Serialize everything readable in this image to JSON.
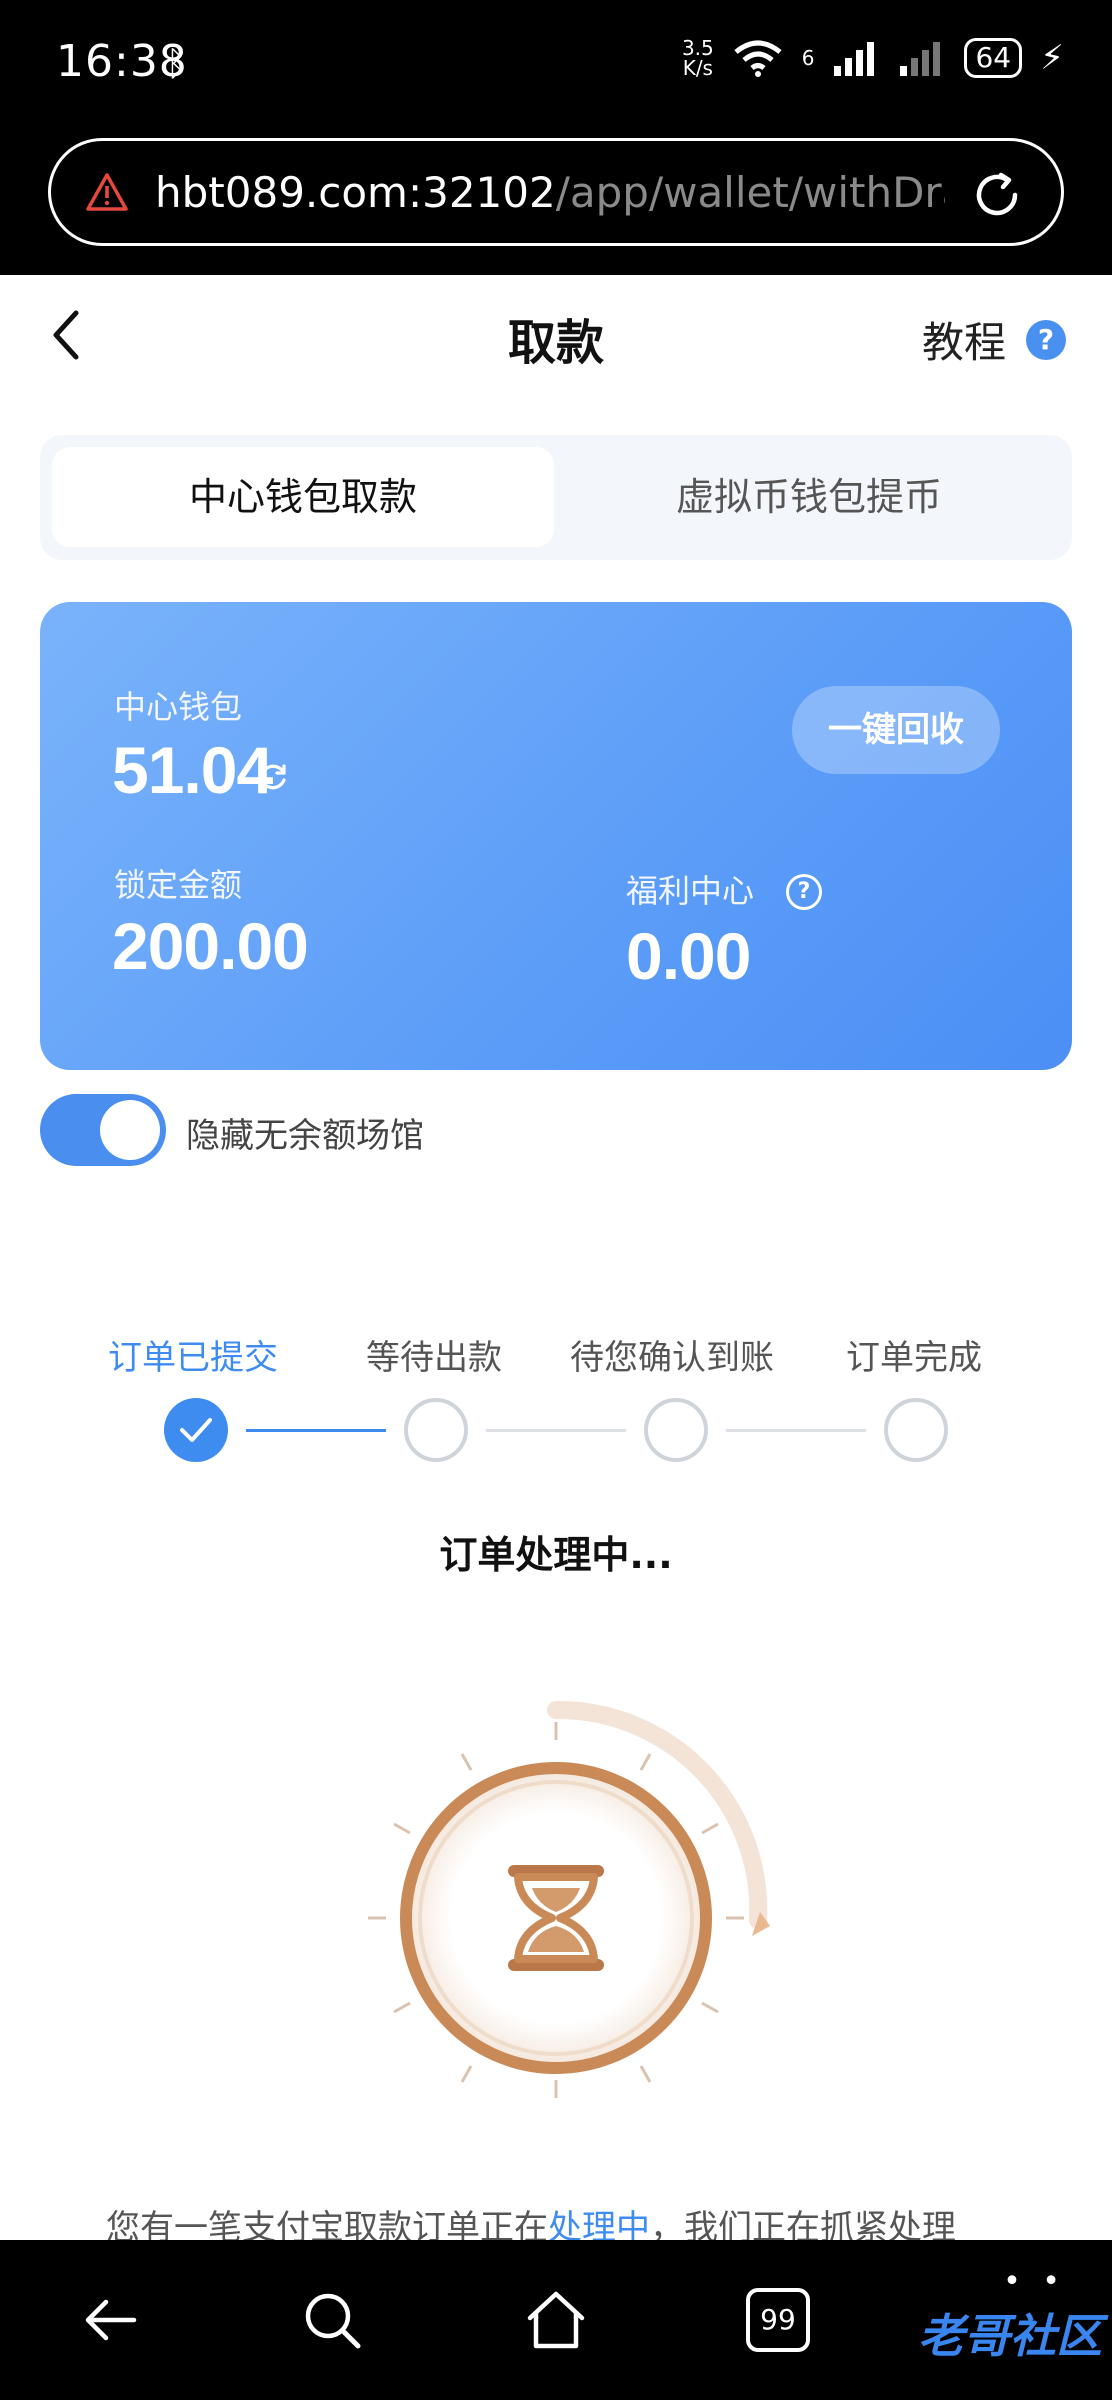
{
  "status_bar": {
    "time": "16:38",
    "net_speed_value": "3.5",
    "net_speed_unit": "K/s",
    "net_type": "6",
    "battery": "64"
  },
  "browser": {
    "url_host": "hbt089.com:32102",
    "url_path": "/app/wallet/withDra"
  },
  "header": {
    "title": "取款",
    "tutorial_label": "教程",
    "help_glyph": "?"
  },
  "tabs": [
    {
      "label": "中心钱包取款",
      "active": true
    },
    {
      "label": "虚拟币钱包提币",
      "active": false
    }
  ],
  "wallet": {
    "center_label": "中心钱包",
    "center_amount": "51.04",
    "recycle_button": "一键回收",
    "locked_label": "锁定金额",
    "locked_amount": "200.00",
    "welfare_label": "福利中心",
    "welfare_amount": "0.00",
    "help_glyph": "?"
  },
  "toggle": {
    "label": "隐藏无余额场馆",
    "on": true
  },
  "steps": [
    {
      "label": "订单已提交",
      "done": true
    },
    {
      "label": "等待出款",
      "done": false
    },
    {
      "label": "待您确认到账",
      "done": false
    },
    {
      "label": "订单完成",
      "done": false
    }
  ],
  "status_title": "订单处理中...",
  "notice": {
    "prefix": "您有一笔支付宝取款订单正在",
    "highlight": "处理中",
    "suffix": "，我们正在抓紧处理"
  },
  "nav": {
    "tabs_count": "99",
    "watermark": "老哥社区"
  },
  "colors": {
    "accent": "#3f8cf0",
    "card_gradient_start": "#7ab3fb",
    "card_gradient_end": "#4b8ff5",
    "hourglass": "#c98a58"
  }
}
